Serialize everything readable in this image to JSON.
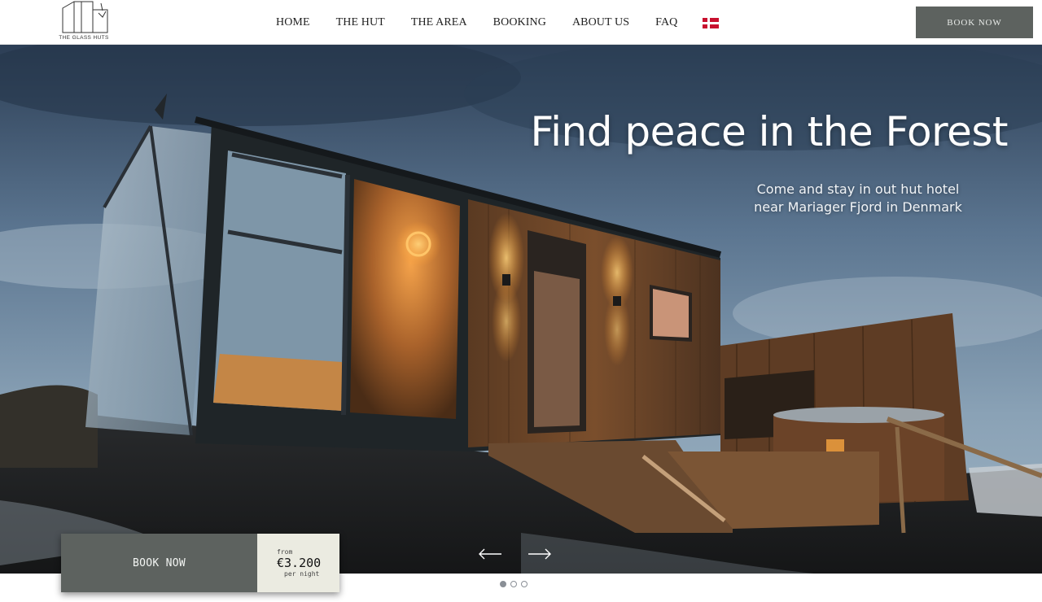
{
  "logo": {
    "text": "THE GLASS HUTS",
    "icon": "glass-hut-logo-icon"
  },
  "nav": {
    "items": [
      {
        "label": "HOME"
      },
      {
        "label": "THE HUT"
      },
      {
        "label": "THE AREA"
      },
      {
        "label": "BOOKING"
      },
      {
        "label": "ABOUT US"
      },
      {
        "label": "FAQ"
      }
    ],
    "language_flag": "danish-flag-icon"
  },
  "header": {
    "book_label": "BOOK NOW"
  },
  "hero": {
    "title": "Find peace in the Forest",
    "subtitle_line1": "Come and stay in out hut hotel",
    "subtitle_line2": "near Mariager Fjord in Denmark",
    "image": "glass-hut-photo"
  },
  "booking_widget": {
    "book_label": "BOOK NOW",
    "from_label": "from",
    "price": "€3.200",
    "per_label": "per night"
  },
  "slider": {
    "prev_icon": "arrow-left-icon",
    "next_icon": "arrow-right-icon",
    "slide_count": 3,
    "active_slide": 1
  },
  "colors": {
    "button_bg": "#5d625f",
    "price_bg": "#ebebe1",
    "flag_red": "#c8102e"
  }
}
